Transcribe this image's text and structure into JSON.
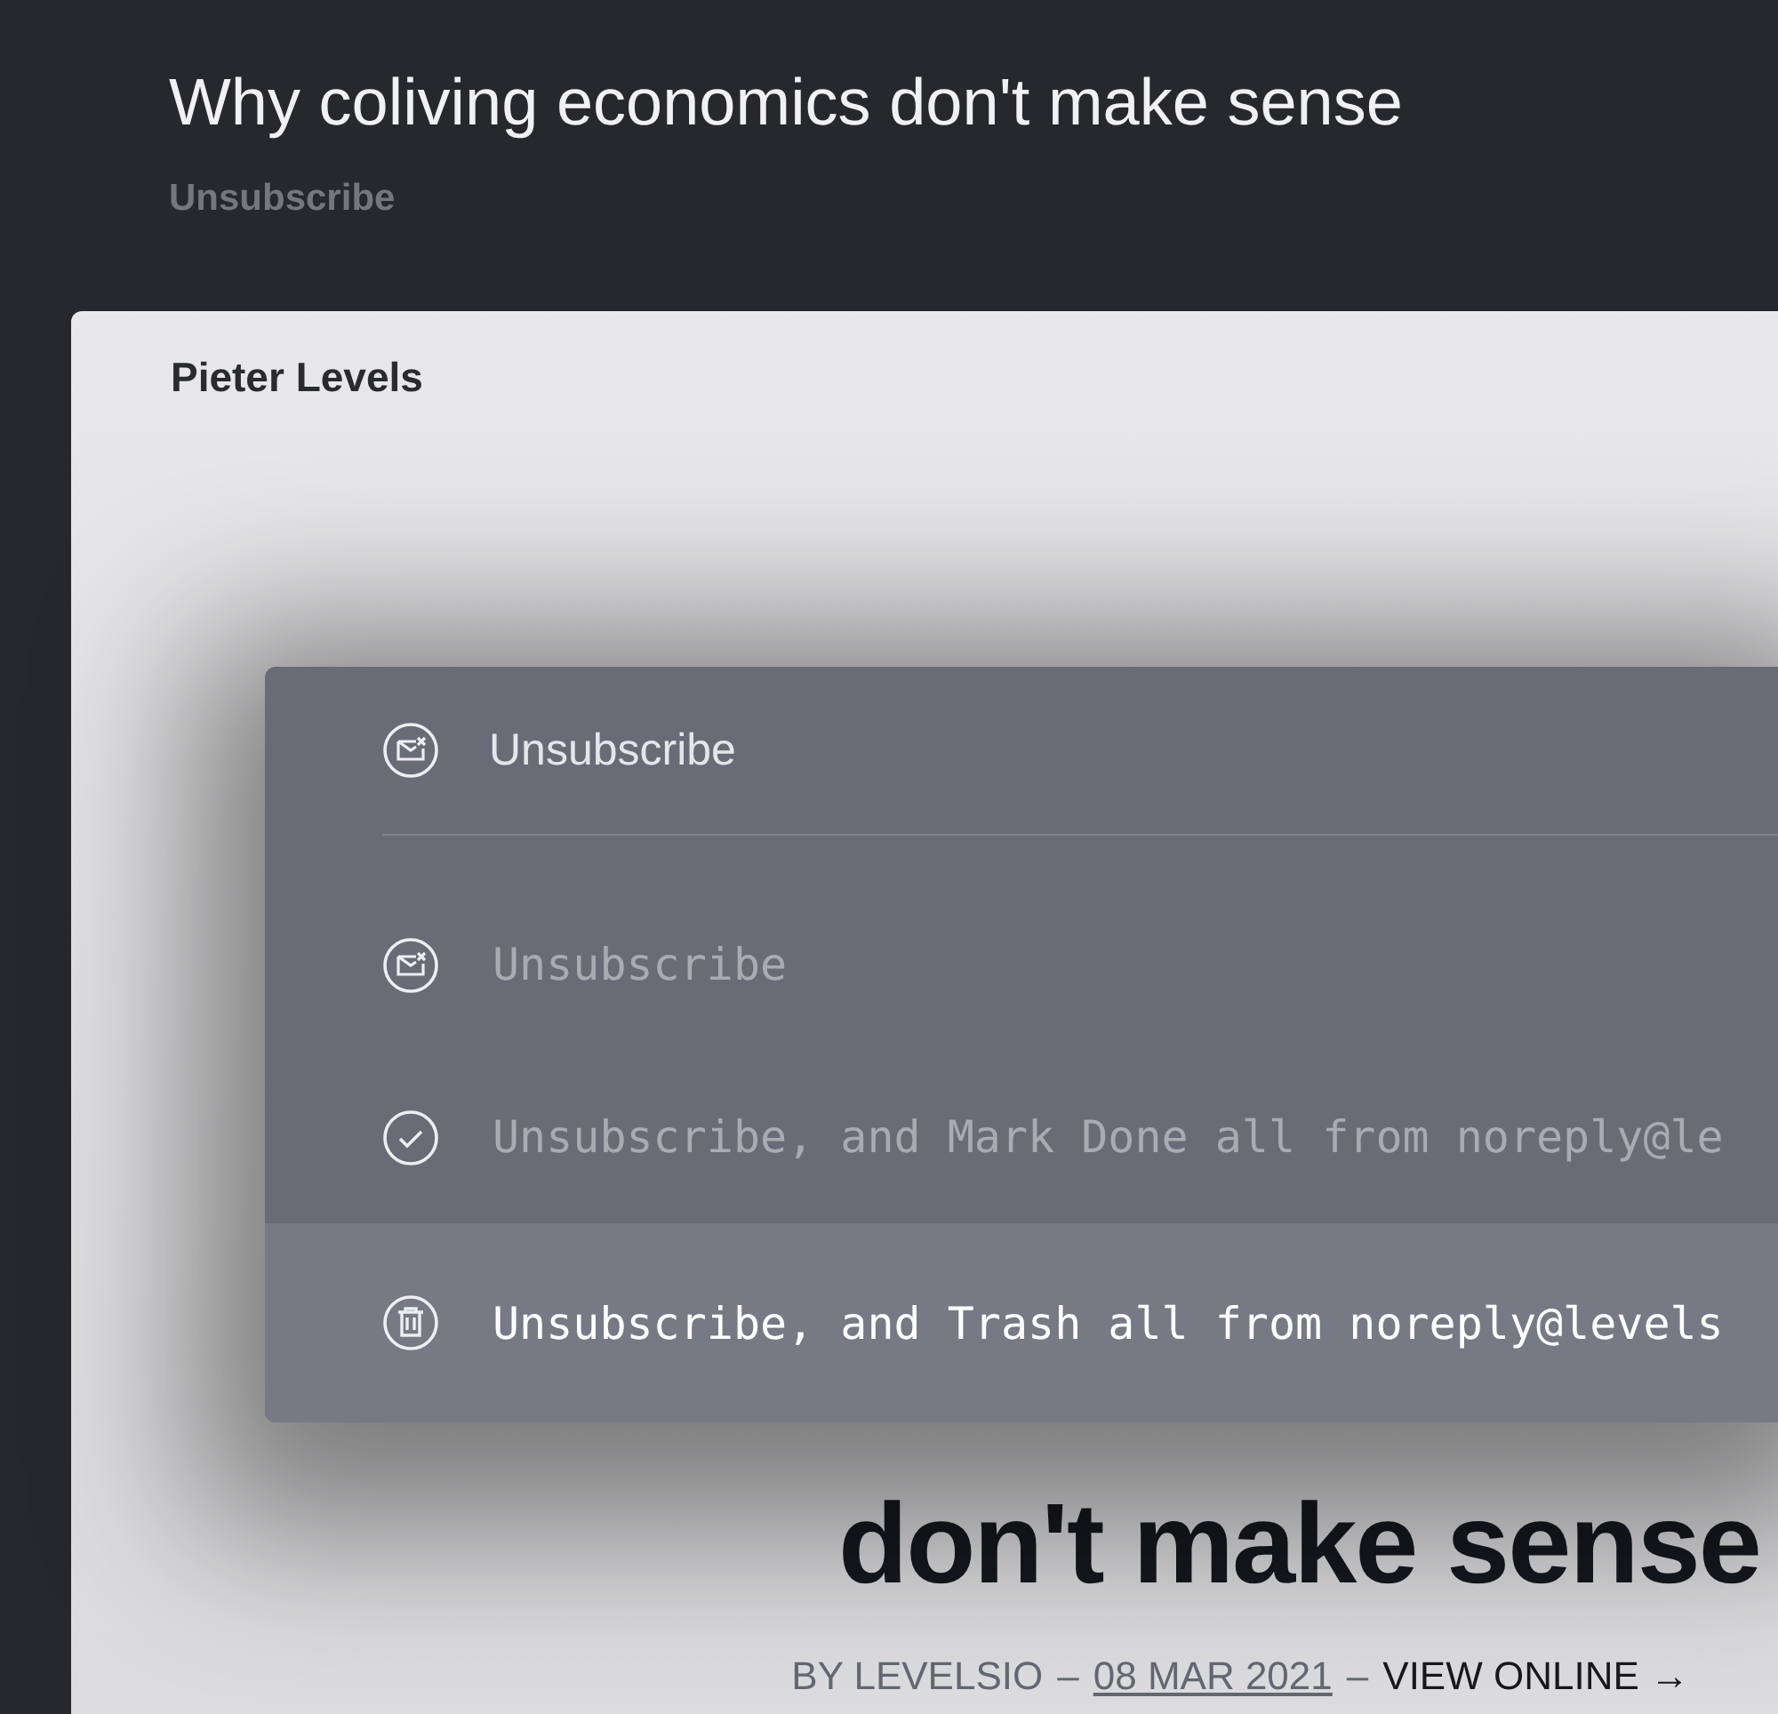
{
  "header": {
    "subject": "Why coliving economics don't make sense",
    "unsubscribe_link": "Unsubscribe"
  },
  "email": {
    "sender": "Pieter Levels",
    "headline_visible": "don't make sense",
    "byline": {
      "author": "BY LEVELSIO",
      "separator_1": "–",
      "date": "08 MAR 2021",
      "separator_2": "–",
      "view_online": "VIEW ONLINE →"
    }
  },
  "command_menu": {
    "search": {
      "value": "Unsubscribe"
    },
    "results": [
      {
        "kind": "unsubscribe",
        "label": "Unsubscribe",
        "selected": false
      },
      {
        "kind": "done",
        "label": "Unsubscribe, and Mark Done all from noreply@le",
        "selected": false
      },
      {
        "kind": "trash",
        "label": "Unsubscribe, and Trash all from noreply@levels",
        "selected": true
      }
    ]
  }
}
